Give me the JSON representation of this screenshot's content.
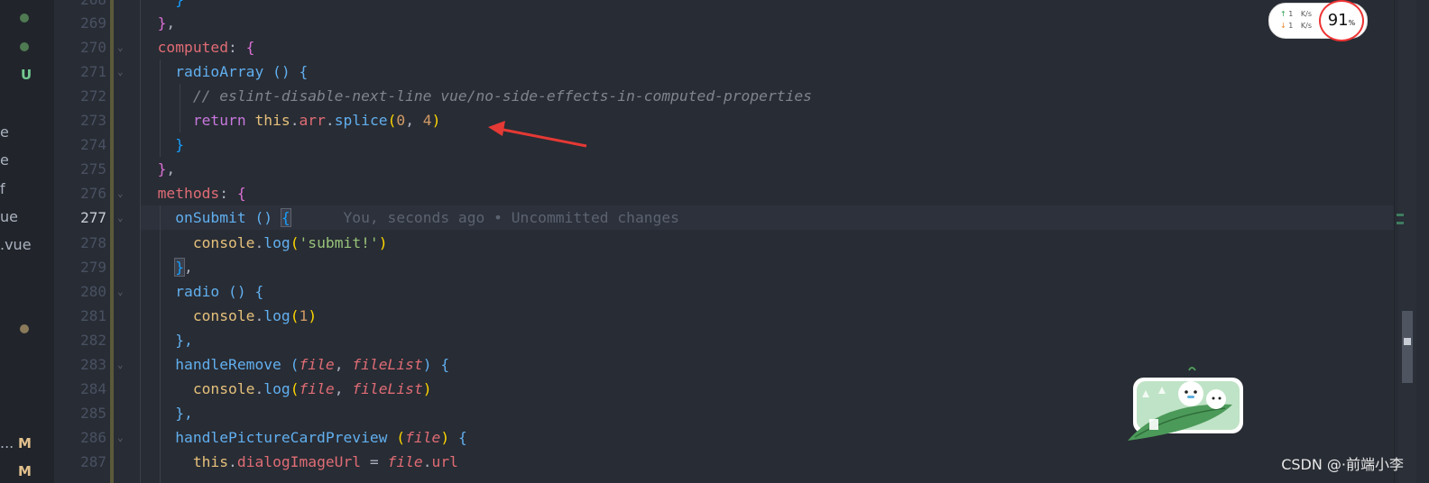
{
  "explorer": {
    "badges": [
      "U",
      "M",
      "M"
    ],
    "files": [
      "e",
      "e",
      "f",
      "ue",
      ".vue",
      "..."
    ]
  },
  "editor": {
    "line_numbers": [
      "268",
      "269",
      "270",
      "271",
      "272",
      "273",
      "274",
      "275",
      "276",
      "277",
      "278",
      "279",
      "280",
      "281",
      "282",
      "283",
      "284",
      "285",
      "286",
      "287"
    ],
    "active_line": "277",
    "blame_text": "You, seconds ago • Uncommitted changes",
    "code": {
      "l268_brace": "}",
      "l269_brace": "}",
      "l269_comma": ",",
      "computed_key": "computed",
      "colon1": ": ",
      "l270_brace": "{",
      "radioArray_name": "radioArray",
      "radioArray_rest": " () {",
      "eslint_comment": "// eslint-disable-next-line vue/no-side-effects-in-computed-properties",
      "return_kw": "return",
      "this_kw": "this",
      "dot1": ".",
      "arr_prop": "arr",
      "dot2": ".",
      "splice_fn": "splice",
      "paren_open": "(",
      "num0": "0",
      "comma_sep": ", ",
      "num4": "4",
      "paren_close": ")",
      "l274_brace": "}",
      "l275_brace": "}",
      "l275_comma": ",",
      "methods_key": "methods",
      "colon2": ": ",
      "l276_brace": "{",
      "onSubmit_name": "onSubmit",
      "onSubmit_parens": " () ",
      "onSubmit_brace": "{",
      "console1": "console",
      "dot3": ".",
      "log1": "log",
      "lp1": "(",
      "submit_str": "'submit!'",
      "rp1": ")",
      "l279_brace": "}",
      "l279_comma": ",",
      "radio_name": "radio",
      "radio_rest": " () {",
      "console2": "console",
      "dot4": ".",
      "log2": "log",
      "lp2": "(",
      "num1": "1",
      "rp2": ")",
      "l282_close": "},",
      "handleRemove_name": "handleRemove",
      "hr_space": " ",
      "hr_lp": "(",
      "file_param1": "file",
      "hr_comma": ", ",
      "fileList_param1": "fileList",
      "hr_rp": ")",
      "hr_brace": " {",
      "console3": "console",
      "dot5": ".",
      "log3": "log",
      "lp3": "(",
      "file_arg": "file",
      "comma3": ", ",
      "fileList_arg": "fileList",
      "rp3": ")",
      "l285_close": "},",
      "hpcp_name": "handlePictureCardPreview",
      "hpcp_space": " ",
      "hpcp_lp": "(",
      "file_param2": "file",
      "hpcp_rp": ")",
      "hpcp_brace": " {",
      "this2": "this",
      "dot6": ".",
      "dialog_prop": "dialogImageUrl",
      "eq": " = ",
      "file_ref": "file",
      "dot7": ".",
      "url_prop": "url"
    }
  },
  "network_widget": {
    "up_value": "1",
    "up_unit": "K/s",
    "down_value": "1",
    "down_unit": "K/s",
    "percent_value": "91",
    "percent_sign": "%",
    "percent_level": 0.91
  },
  "watermark": "CSDN @·前端小李",
  "colors": {
    "editor_bg": "#282c34",
    "keyword": "#c678dd",
    "property": "#e06c75",
    "function": "#61afef",
    "number": "#d19a66",
    "string": "#98c379",
    "git_untracked": "#73c991",
    "git_modified": "#e2c08d",
    "annotation_arrow": "#e53935"
  },
  "icons": [
    "arrow-up-icon",
    "arrow-down-icon",
    "fold-chevron-icon",
    "sticker-image"
  ]
}
